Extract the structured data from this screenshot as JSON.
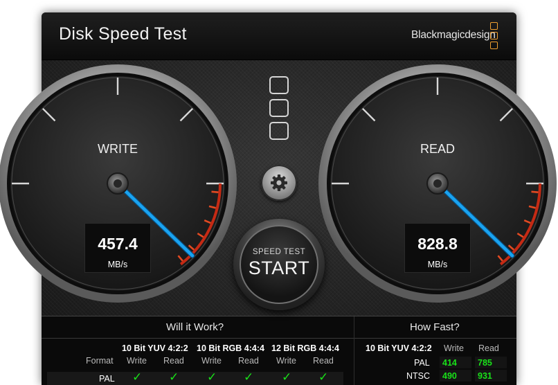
{
  "app": {
    "title": "Disk Speed Test",
    "brand": "Blackmagicdesign"
  },
  "colors": {
    "accent": "#f0a030",
    "needle": "#1aa3f0",
    "green": "#19e119",
    "redzone": "#d02010"
  },
  "gauges": {
    "write": {
      "label": "WRITE",
      "value": "457.4",
      "unit": "MB/s"
    },
    "read": {
      "label": "READ",
      "value": "828.8",
      "unit": "MB/s"
    }
  },
  "start_button": {
    "small": "SPEED TEST",
    "big": "START"
  },
  "settings_icon": "gear-icon",
  "will_it_work": {
    "heading": "Will it Work?",
    "format_label": "Format",
    "groups": [
      {
        "name": "10 Bit YUV 4:2:2",
        "write": "Write",
        "read": "Read"
      },
      {
        "name": "10 Bit RGB 4:4:4",
        "write": "Write",
        "read": "Read"
      },
      {
        "name": "12 Bit RGB 4:4:4",
        "write": "Write",
        "read": "Read"
      }
    ],
    "rows": [
      {
        "format": "PAL",
        "checks": [
          "✓",
          "✓",
          "✓",
          "✓",
          "✓",
          "✓"
        ]
      }
    ]
  },
  "how_fast": {
    "heading": "How Fast?",
    "group": "10 Bit YUV 4:2:2",
    "write": "Write",
    "read": "Read",
    "rows": [
      {
        "format": "PAL",
        "write": "414",
        "read": "785"
      },
      {
        "format": "NTSC",
        "write": "490",
        "read": "931"
      }
    ]
  }
}
